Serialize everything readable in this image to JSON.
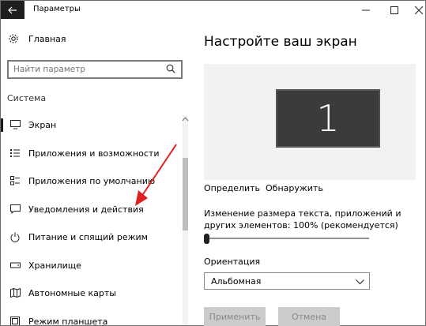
{
  "window": {
    "title": "Параметры"
  },
  "sidebar": {
    "home_label": "Главная",
    "search_placeholder": "Найти параметр",
    "section_title": "Система",
    "items": [
      {
        "label": "Экран",
        "icon": "monitor-icon"
      },
      {
        "label": "Приложения и возможности",
        "icon": "apps-list-icon"
      },
      {
        "label": "Приложения по умолчанию",
        "icon": "default-apps-icon"
      },
      {
        "label": "Уведомления и действия",
        "icon": "notifications-icon"
      },
      {
        "label": "Питание и спящий режим",
        "icon": "power-icon"
      },
      {
        "label": "Хранилище",
        "icon": "storage-icon"
      },
      {
        "label": "Автономные карты",
        "icon": "offline-maps-icon"
      },
      {
        "label": "Режим планшета",
        "icon": "tablet-mode-icon"
      }
    ]
  },
  "main": {
    "title": "Настройте ваш экран",
    "monitor_number": "1",
    "identify_label": "Определить",
    "detect_label": "Обнаружить",
    "scale_label": "Изменение размера текста, приложений и других элементов: 100% (рекомендуется)",
    "scale_percent": 100,
    "orientation_label": "Ориентация",
    "orientation_value": "Альбомная",
    "apply_label": "Применить",
    "cancel_label": "Отмена"
  },
  "colors": {
    "accent_dark": "#1f1f1f",
    "annotation_red": "#e02020",
    "display_bg": "#f2f2f2",
    "monitor_fill": "#3b3b3b",
    "disabled_button": "#cccccc"
  }
}
